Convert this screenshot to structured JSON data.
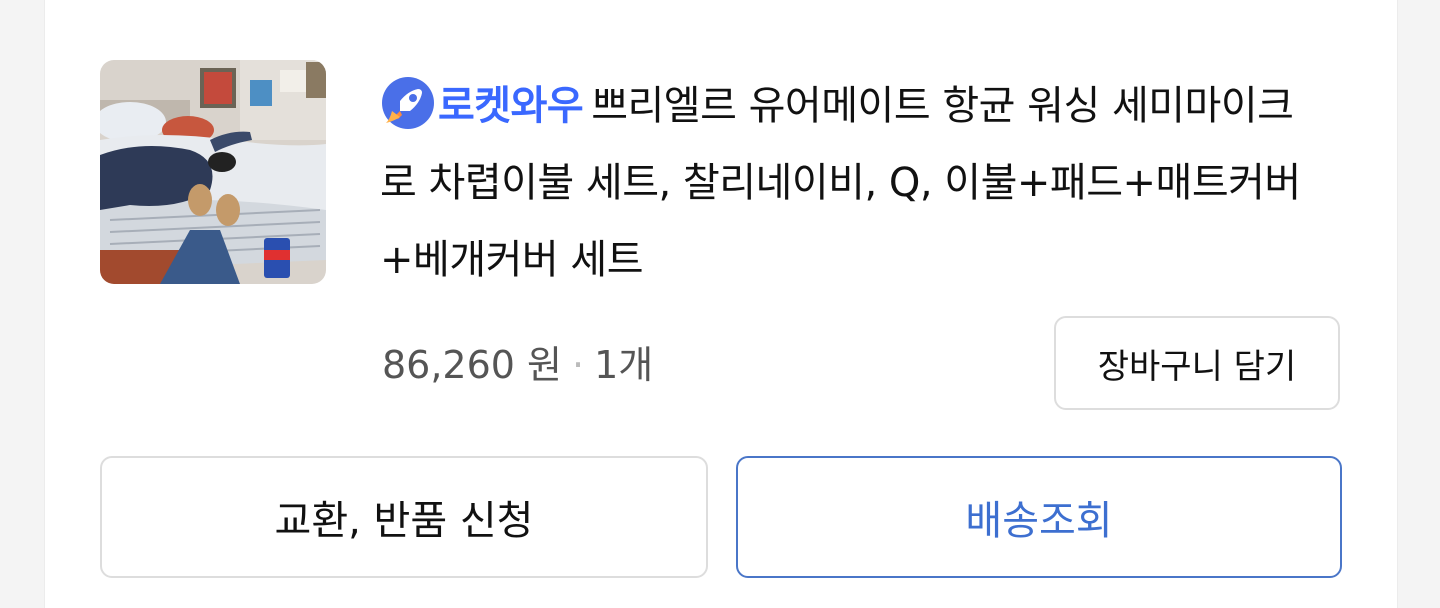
{
  "order_item": {
    "badge": {
      "icon": "rocket-icon",
      "text": "로켓와우",
      "color": "#3a68ff"
    },
    "product_title": "쁘리엘르 유어메이트 항균 워싱 세미마이크로 차렵이불 세트, 찰리네이비, Q, 이불+패드+매트커버+베개커버 세트",
    "price": "86,260 원",
    "separator": "·",
    "quantity": "1개",
    "thumbnail": "product-photo-bedding"
  },
  "actions": {
    "add_to_cart": "장바구니 담기",
    "exchange_return": "교환, 반품 신청",
    "track_delivery": "배송조회",
    "track_delivery_color": "#3d6fd0"
  }
}
